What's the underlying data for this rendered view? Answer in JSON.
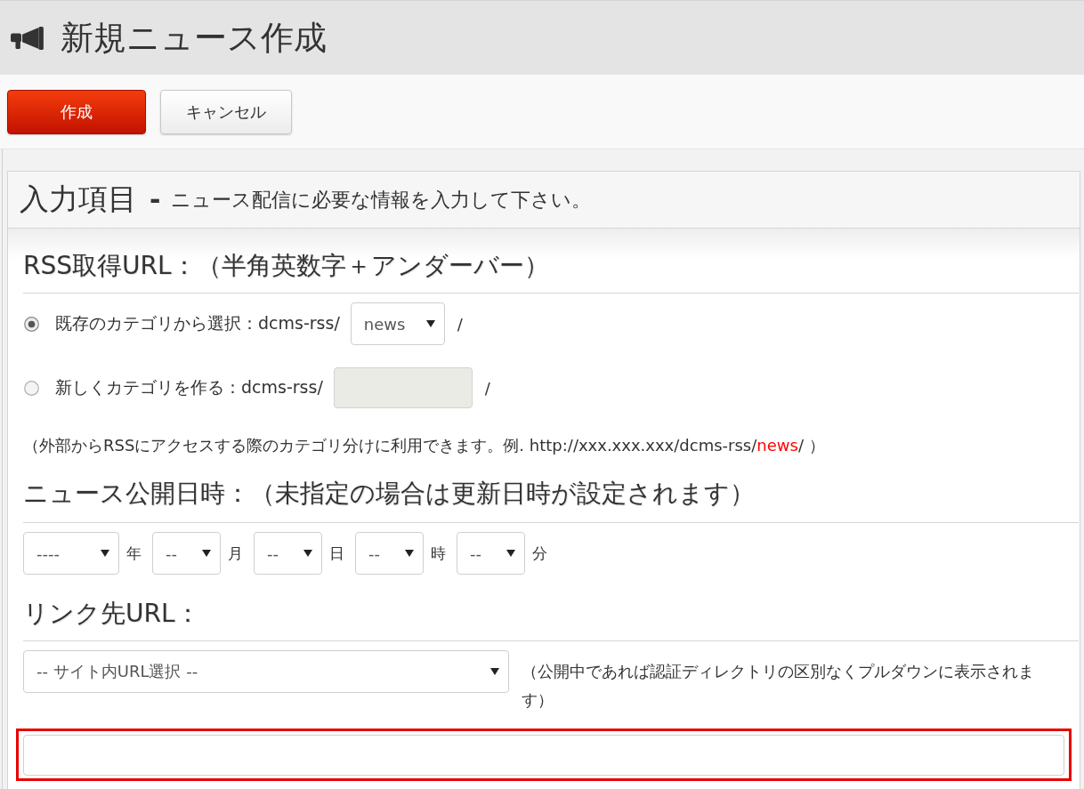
{
  "header": {
    "title": "新規ニュース作成"
  },
  "toolbar": {
    "buttons": [
      {
        "label": "作成",
        "kind": "primary"
      },
      {
        "label": "キャンセル",
        "kind": "default"
      }
    ]
  },
  "panel": {
    "title": "入力項目",
    "separator": "-",
    "subtitle": "ニュース配信に必要な情報を入力して下さい。"
  },
  "rss_url": {
    "heading": "RSS取得URL：（半角英数字＋アンダーバー）",
    "options": [
      {
        "kind": "select",
        "label": "既存のカテゴリから選択：dcms-rss/",
        "selected": true,
        "value": "news",
        "suffix": "/"
      },
      {
        "kind": "text",
        "label": "新しくカテゴリを作る：dcms-rss/",
        "selected": false,
        "disabled": true,
        "suffix": "/"
      }
    ],
    "note": [
      {
        "kind": "plain",
        "text": "（外部からRSSにアクセスする際のカテゴリ分けに利用できます。例.  http://xxx.xxx.xxx/dcms-rss/"
      },
      {
        "kind": "highlight",
        "text": "news"
      },
      {
        "kind": "plain",
        "text": "/ ）"
      }
    ]
  },
  "publish_date": {
    "heading": "ニュース公開日時：（未指定の場合は更新日時が設定されます）",
    "fields": [
      {
        "kind": "year",
        "value": "----",
        "unit": "年"
      },
      {
        "kind": "part",
        "value": "--",
        "unit": "月"
      },
      {
        "kind": "part",
        "value": "--",
        "unit": "日"
      },
      {
        "kind": "part",
        "value": "--",
        "unit": "時"
      },
      {
        "kind": "part",
        "value": "--",
        "unit": "分"
      }
    ]
  },
  "link_url": {
    "heading": "リンク先URL：",
    "select": {
      "value": "-- サイト内URL選択 --"
    },
    "note": "（公開中であれば認証ディレクトリの区別なくプルダウンに表示されます）",
    "input": {
      "highlighted": true
    }
  }
}
